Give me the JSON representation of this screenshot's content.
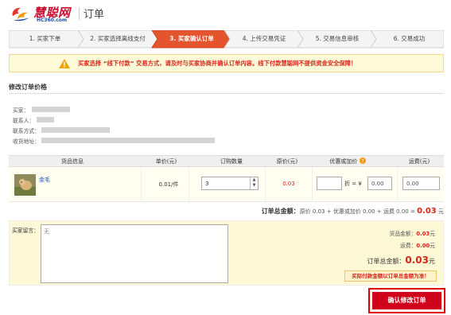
{
  "header": {
    "logo_text": "慧聪网",
    "logo_sub": "HC360.com",
    "page_title": "订单"
  },
  "steps": [
    {
      "label": "1. 买家下单",
      "active": false
    },
    {
      "label": "2. 买家选择离线支付",
      "active": false
    },
    {
      "label": "3. 买家确认订单",
      "active": true
    },
    {
      "label": "4. 上传交易凭证",
      "active": false
    },
    {
      "label": "5. 交易信息审核",
      "active": false
    },
    {
      "label": "6. 交易成功",
      "active": false
    }
  ],
  "warning": {
    "icon": "warning-triangle-icon",
    "text": "买家选择 “线下付款” 交易方式，请及时与买家协商并确认订单内容。线下付款慧聪网不提供资金安全保障！"
  },
  "section_title": "修改订单价格",
  "buyer_info": {
    "buyer_label": "买家：",
    "contact_label": "联系人：",
    "phone_label": "联系方式：",
    "address_label": "收货地址："
  },
  "table": {
    "headers": [
      "货品信息",
      "单价(元)",
      "订购数量",
      "原价(元)",
      "优惠或加价",
      "运费(元)"
    ],
    "row": {
      "product_name": "金毛",
      "unit_price": "0.01/件",
      "quantity": "3",
      "original_price": "0.03",
      "discount_value": "",
      "discount_unit": "折 = ¥",
      "adjust_value": "0.00",
      "shipping_value": "0.00"
    }
  },
  "order_total_line": {
    "label": "订单总金额：",
    "formula_prefix": "原价 0.03 + 优惠或加价 0.00 + 运费 0.00 = ",
    "total": "0.03",
    "unit": "元"
  },
  "remark": {
    "label": "买家留言：",
    "value": "无"
  },
  "summary": {
    "goods_label": "货品金额：",
    "goods_value": "0.03",
    "shipping_label": "运费：",
    "shipping_value": "0.00",
    "unit": "元",
    "total_label": "订单总金额：",
    "total_value": "0.03",
    "note": "买际付款金额以订单总金额为准！"
  },
  "confirm_button": "确认修改订单",
  "colors": {
    "brand_red": "#d0021b",
    "step_active": "#e4542d",
    "link_blue": "#1a56a8",
    "warning_bg": "#fffbd8"
  }
}
